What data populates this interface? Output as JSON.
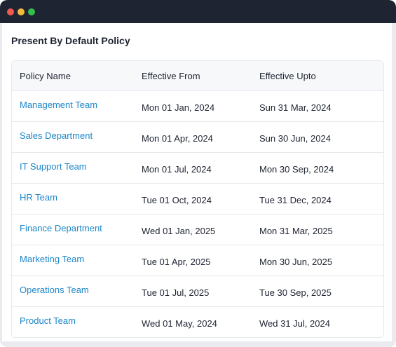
{
  "window": {
    "controls": [
      "close",
      "minimize",
      "maximize"
    ],
    "colors": {
      "close": "#f05a4f",
      "minimize": "#f5b93a",
      "maximize": "#35c04d",
      "titlebar": "#1f2433",
      "link": "#1d86c8"
    }
  },
  "section": {
    "title": "Present By Default Policy"
  },
  "table": {
    "columns": [
      "Policy Name",
      "Effective From",
      "Effective Upto"
    ],
    "rows": [
      {
        "name": "Management Team",
        "from": "Mon 01 Jan, 2024",
        "upto": "Sun 31 Mar, 2024"
      },
      {
        "name": "Sales Department",
        "from": "Mon 01 Apr, 2024",
        "upto": "Sun 30 Jun, 2024"
      },
      {
        "name": "IT Support Team",
        "from": "Mon 01 Jul, 2024",
        "upto": "Mon 30 Sep, 2024"
      },
      {
        "name": "HR Team",
        "from": "Tue 01 Oct, 2024",
        "upto": "Tue 31 Dec, 2024"
      },
      {
        "name": "Finance Department",
        "from": "Wed 01 Jan, 2025",
        "upto": "Mon 31 Mar, 2025"
      },
      {
        "name": "Marketing Team",
        "from": "Tue 01 Apr, 2025",
        "upto": "Mon 30 Jun, 2025"
      },
      {
        "name": "Operations Team",
        "from": "Tue 01 Jul, 2025",
        "upto": "Tue 30 Sep, 2025"
      },
      {
        "name": "Product Team",
        "from": "Wed 01 May, 2024",
        "upto": "Wed 31 Jul, 2024"
      }
    ]
  }
}
